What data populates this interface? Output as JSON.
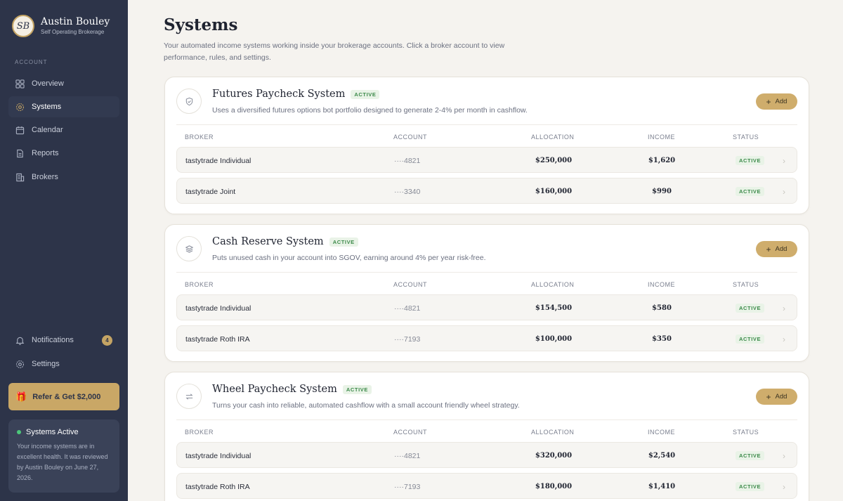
{
  "brand": {
    "logo_text": "SB",
    "name": "Austin Bouley",
    "subtitle": "Self Operating Brokerage"
  },
  "sidebar": {
    "section_label": "ACCOUNT",
    "items": [
      {
        "label": "Overview",
        "icon": "grid-icon"
      },
      {
        "label": "Systems",
        "icon": "gear-icon",
        "active": true
      },
      {
        "label": "Calendar",
        "icon": "calendar-icon"
      },
      {
        "label": "Reports",
        "icon": "document-icon"
      },
      {
        "label": "Brokers",
        "icon": "building-icon"
      }
    ],
    "notifications": {
      "label": "Notifications",
      "count": "4",
      "icon": "bell-icon"
    },
    "settings": {
      "label": "Settings",
      "icon": "gear-icon"
    },
    "refer": {
      "label": "Refer & Get $2,000",
      "icon": "gift-icon"
    },
    "status_card": {
      "title": "Systems Active",
      "body": "Your income systems are in excellent health. It was reviewed by Austin Bouley on June 27, 2026."
    }
  },
  "page": {
    "title": "Systems",
    "description": "Your automated income systems working inside your brokerage accounts. Click a broker account to view performance, rules, and settings."
  },
  "table_headers": {
    "broker": "BROKER",
    "account": "ACCOUNT",
    "allocation": "ALLOCATION",
    "income": "INCOME",
    "status": "STATUS"
  },
  "systems": [
    {
      "title": "Futures Paycheck System",
      "badge": "ACTIVE",
      "description": "Uses a diversified futures options bot portfolio designed to generate 2-4% per month in cashflow.",
      "icon": "shield-icon",
      "add_label": "Add",
      "rows": [
        {
          "broker": "tastytrade Individual",
          "account": "····4821",
          "allocation": "$250,000",
          "income": "$1,620",
          "status": "ACTIVE"
        },
        {
          "broker": "tastytrade Joint",
          "account": "····3340",
          "allocation": "$160,000",
          "income": "$990",
          "status": "ACTIVE"
        }
      ]
    },
    {
      "title": "Cash Reserve System",
      "badge": "ACTIVE",
      "description": "Puts unused cash in your account into SGOV, earning around 4% per year risk-free.",
      "icon": "layers-icon",
      "add_label": "Add",
      "rows": [
        {
          "broker": "tastytrade Individual",
          "account": "····4821",
          "allocation": "$154,500",
          "income": "$580",
          "status": "ACTIVE"
        },
        {
          "broker": "tastytrade Roth IRA",
          "account": "····7193",
          "allocation": "$100,000",
          "income": "$350",
          "status": "ACTIVE"
        }
      ]
    },
    {
      "title": "Wheel Paycheck System",
      "badge": "ACTIVE",
      "description": "Turns your cash into reliable, automated cashflow with a small account friendly wheel strategy.",
      "icon": "swap-arrows-icon",
      "add_label": "Add",
      "rows": [
        {
          "broker": "tastytrade Individual",
          "account": "····4821",
          "allocation": "$320,000",
          "income": "$2,540",
          "status": "ACTIVE"
        },
        {
          "broker": "tastytrade Roth IRA",
          "account": "····7193",
          "allocation": "$180,000",
          "income": "$1,410",
          "status": "ACTIVE"
        }
      ]
    }
  ],
  "colors": {
    "sidebar_bg": "#2d3449",
    "accent_gold": "#c9a766",
    "active_green": "#3c8a4a",
    "page_bg": "#f5f3ef"
  }
}
